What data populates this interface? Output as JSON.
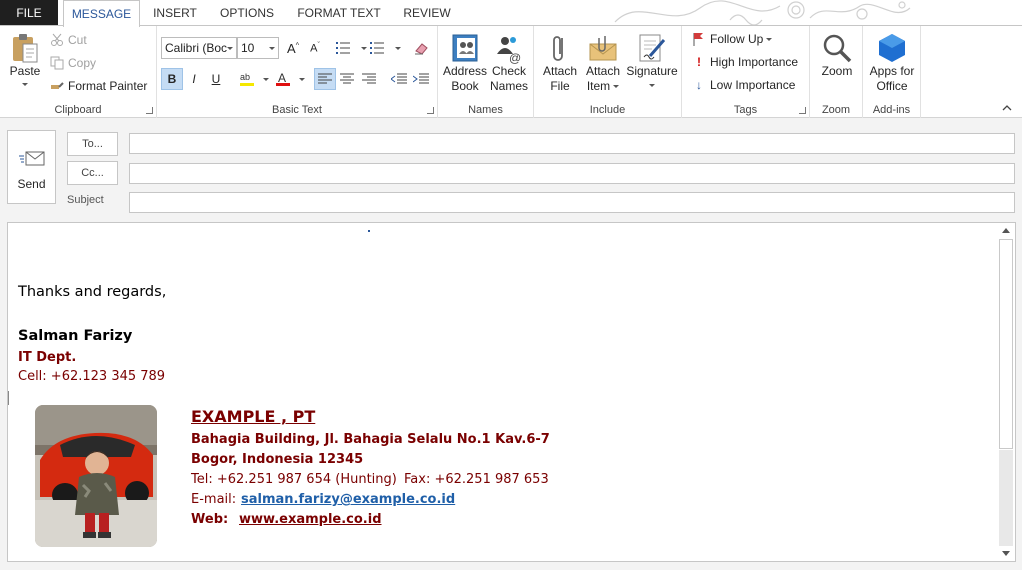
{
  "tabs": {
    "file": "FILE",
    "message": "MESSAGE",
    "insert": "INSERT",
    "options": "OPTIONS",
    "format_text": "FORMAT TEXT",
    "review": "REVIEW"
  },
  "ribbon": {
    "clipboard": {
      "label": "Clipboard",
      "paste": "Paste",
      "cut": "Cut",
      "copy": "Copy",
      "format_painter": "Format Painter"
    },
    "basic_text": {
      "label": "Basic Text",
      "font_name": "Calibri (Boc",
      "font_size": "10",
      "bold": "B",
      "italic": "I",
      "underline": "U"
    },
    "names": {
      "label": "Names",
      "address_book_1": "Address",
      "address_book_2": "Book",
      "check_names_1": "Check",
      "check_names_2": "Names"
    },
    "include": {
      "label": "Include",
      "attach_file_1": "Attach",
      "attach_file_2": "File",
      "attach_item_1": "Attach",
      "attach_item_2": "Item",
      "signature": "Signature"
    },
    "tags": {
      "label": "Tags",
      "follow_up": "Follow Up",
      "high_importance": "High Importance",
      "low_importance": "Low Importance"
    },
    "zoom": {
      "label": "Zoom",
      "zoom": "Zoom"
    },
    "addins": {
      "label": "Add-ins",
      "apps_1": "Apps for",
      "apps_2": "Office"
    }
  },
  "compose": {
    "send": "Send",
    "to": "To...",
    "cc": "Cc...",
    "subject_label": "Subject",
    "to_value": "",
    "cc_value": "",
    "subject_value": ""
  },
  "body": {
    "greeting": "Thanks and regards,",
    "name": "Salman Farizy",
    "dept": "IT Dept.",
    "cell": "Cell: +62.123 345 789",
    "company": "EXAMPLE , PT",
    "address1": "Bahagia Building, Jl. Bahagia Selalu No.1 Kav.6-7",
    "address2": "Bogor, Indonesia 12345",
    "tel": "Tel: +62.251 987 654 (Hunting)",
    "fax": "Fax: +62.251 987 653",
    "email_label": "E-mail:",
    "email": "salman.farizy@example.co.id",
    "web_label": "Web:",
    "web": "www.example.co.id"
  },
  "colors": {
    "accent": "#2b579a",
    "signature": "#7a0000",
    "link": "#1f5fa8",
    "file_tab": "#1f1f1f"
  }
}
